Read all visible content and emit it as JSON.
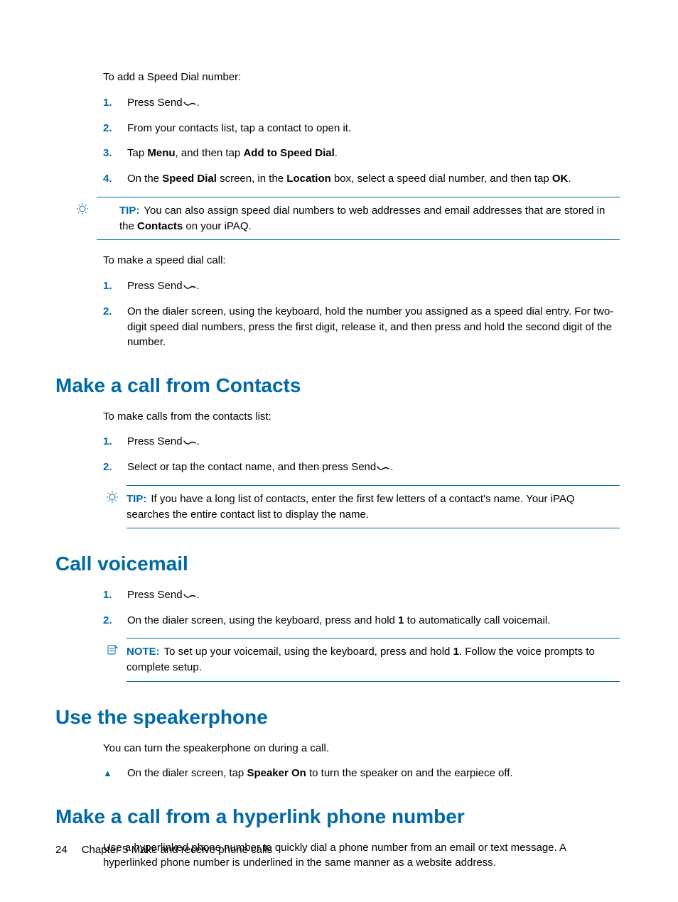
{
  "colors": {
    "accent": "#0069a6"
  },
  "icons": {
    "send": "send-icon",
    "tip": "lightbulb-icon",
    "note": "note-icon",
    "bullet": "triangle-up"
  },
  "speedDialAdd": {
    "intro": "To add a Speed Dial number:",
    "items": {
      "1": {
        "pre": "Press Send",
        "post": "."
      },
      "2": "From your contacts list, tap a contact to open it.",
      "3": {
        "pre": "Tap ",
        "b1": "Menu",
        "mid": ", and then tap ",
        "b2": "Add to Speed Dial",
        "post": "."
      },
      "4": {
        "pre": "On the ",
        "b1": "Speed Dial",
        "mid1": " screen, in the ",
        "b2": "Location",
        "mid2": " box, select a speed dial number, and then tap ",
        "b3": "OK",
        "post": "."
      }
    }
  },
  "tip1": {
    "label": "TIP:",
    "pre": "You can also assign speed dial numbers to web addresses and email addresses that are stored in the ",
    "b": "Contacts",
    "post": " on your iPAQ."
  },
  "speedDialCall": {
    "intro": "To make a speed dial call:",
    "items": {
      "1": {
        "pre": "Press Send",
        "post": "."
      },
      "2": "On the dialer screen, using the keyboard, hold the number you assigned as a speed dial entry. For two-digit speed dial numbers, press the first digit, release it, and then press and hold the second digit of the number."
    }
  },
  "contacts": {
    "heading": "Make a call from Contacts",
    "intro": "To make calls from the contacts list:",
    "items": {
      "1": {
        "pre": "Press Send",
        "post": "."
      },
      "2": {
        "pre": "Select or tap the contact name, and then press Send",
        "post": "."
      }
    },
    "tip": {
      "label": "TIP:",
      "text": "If you have a long list of contacts, enter the first few letters of a contact's name. Your iPAQ searches the entire contact list to display the name."
    }
  },
  "voicemail": {
    "heading": "Call voicemail",
    "items": {
      "1": {
        "pre": "Press Send",
        "post": "."
      },
      "2": {
        "pre": "On the dialer screen, using the keyboard, press and hold ",
        "b": "1",
        "post": " to automatically call voicemail."
      }
    },
    "note": {
      "label": "NOTE:",
      "pre": "To set up your voicemail, using the keyboard, press and hold ",
      "b": "1",
      "post": ". Follow the voice prompts to complete setup."
    }
  },
  "speaker": {
    "heading": "Use the speakerphone",
    "intro": "You can turn the speakerphone on during a call.",
    "bullet": {
      "pre": "On the dialer screen, tap ",
      "b": "Speaker On",
      "post": " to turn the speaker on and the earpiece off."
    }
  },
  "hyperlink": {
    "heading": "Make a call from a hyperlink phone number",
    "intro": "Use a hyperlinked phone number to quickly dial a phone number from an email or text message. A hyperlinked phone number is underlined in the same manner as a website address."
  },
  "footer": {
    "page": "24",
    "chapter": "Chapter 5   Make and receive phone calls"
  }
}
